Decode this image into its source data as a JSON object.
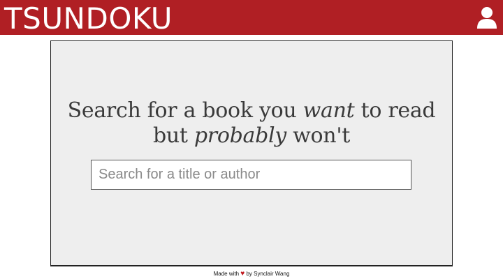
{
  "header": {
    "brand": "TSUNDOKU",
    "user_icon": "user-icon",
    "background": "#b01f24"
  },
  "hero": {
    "line1_start": "Search for a book you ",
    "line1_emphasis": "want",
    "line1_end": " to read",
    "line2_start": "but ",
    "line2_emphasis": "probably",
    "line2_end": " won't"
  },
  "search": {
    "value": "",
    "placeholder": "Search for a title or author"
  },
  "footer": {
    "prefix": "Made with ",
    "heart": "♥",
    "suffix": " by Synclair Wang"
  }
}
